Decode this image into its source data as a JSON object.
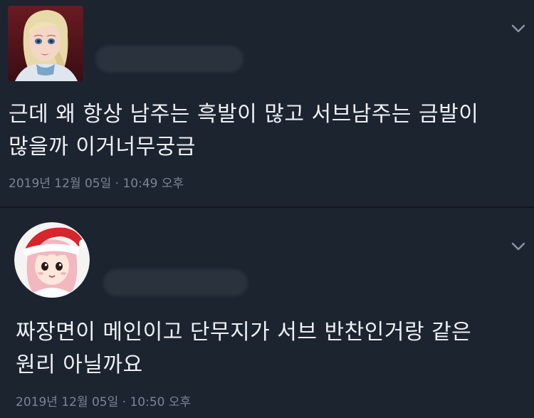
{
  "tweets": [
    {
      "author_name_hidden": true,
      "text_lines": [
        "근데 왜 항상 남주는 흑발이 많고 서브남주는 금발이",
        "많을까 이거너무궁금"
      ],
      "timestamp": "2019년 12월 05일 · 10:49 오후",
      "avatar_icon": "elsa-avatar-icon"
    },
    {
      "author_name_hidden": true,
      "text_lines": [
        "짜장면이 메인이고 단무지가 서브 반찬인거랑 같은",
        "원리 아닐까요"
      ],
      "timestamp": "2019년 12월 05일 · 10:50 오후",
      "avatar_icon": "santa-hat-girl-avatar-icon"
    }
  ],
  "colors": {
    "background": "#1c2430",
    "text": "#eef1f4",
    "meta": "#7a8693",
    "divider": "#121820"
  }
}
